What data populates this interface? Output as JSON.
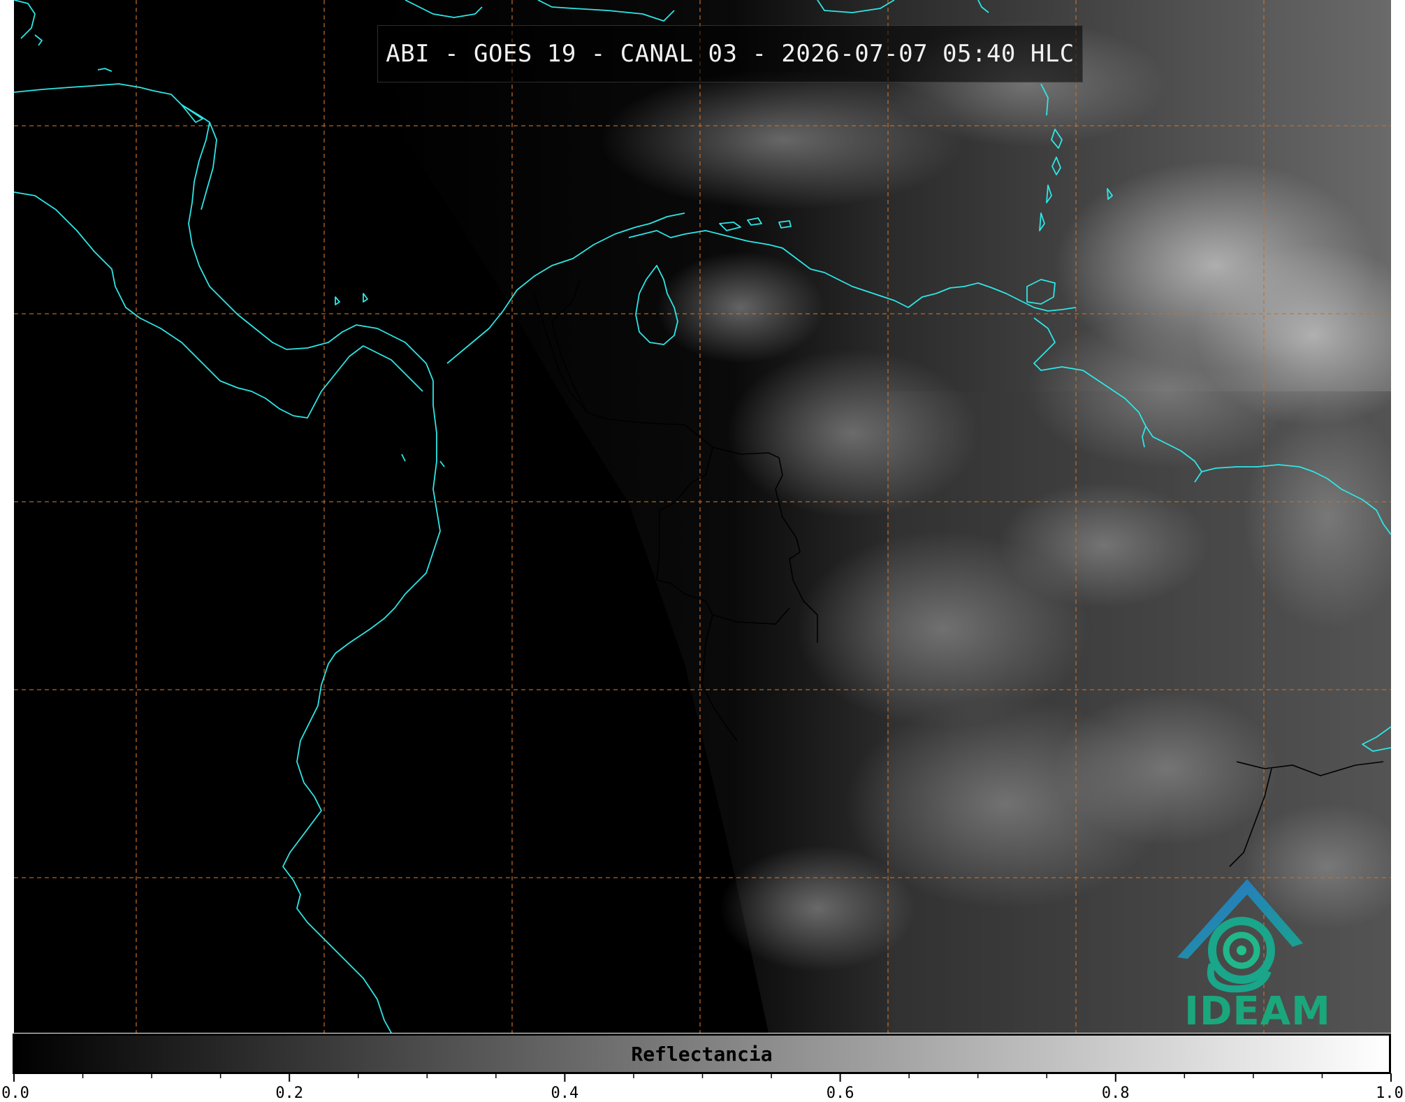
{
  "title": "ABI - GOES 19 - CANAL 03 - 2026-07-07 05:40 HLC",
  "colorbar": {
    "label": "Reflectancia",
    "range": [
      0.0,
      1.0
    ],
    "tick_labels": [
      "0.0",
      "0.2",
      "0.4",
      "0.6",
      "0.8",
      "1.0"
    ],
    "colors": {
      "low": "#000000",
      "high": "#ffffff"
    }
  },
  "logo": {
    "text": "IDEAM",
    "icon": "ideam-mountain-swirl-icon",
    "colors": {
      "mountain": "#2a7ec4",
      "swirl": "#1aa77c"
    }
  },
  "map": {
    "coastline_color": "#2ee6e6",
    "border_color": "#000000",
    "gridline_color": "#c8702a",
    "gridline_style": "dashed",
    "background": "#000000"
  }
}
